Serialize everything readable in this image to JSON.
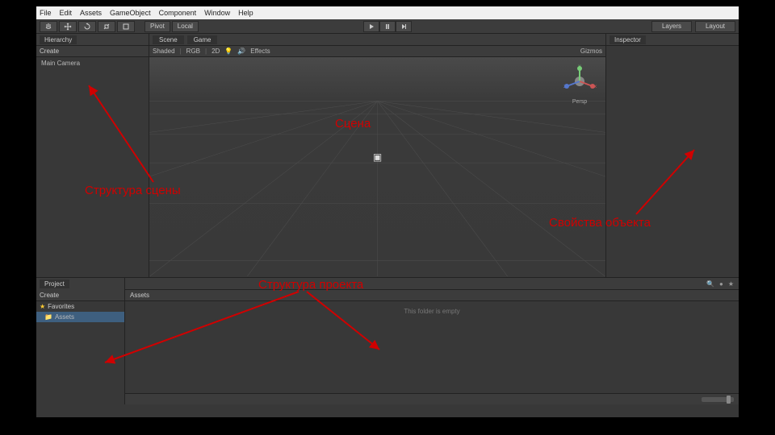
{
  "menubar": [
    "File",
    "Edit",
    "Assets",
    "GameObject",
    "Component",
    "Window",
    "Help"
  ],
  "toolbar": {
    "pivot": "Pivot",
    "local": "Local",
    "layers": "Layers",
    "layout": "Layout"
  },
  "hierarchy": {
    "tab": "Hierarchy",
    "create": "Create",
    "item": "Main Camera"
  },
  "scene": {
    "tab_scene": "Scene",
    "tab_game": "Game",
    "shaded": "Shaded",
    "rgb": "RGB",
    "twod": "2D",
    "effects": "Effects",
    "gizmos": "Gizmos",
    "persp": "Persp"
  },
  "inspector": {
    "tab": "Inspector"
  },
  "project": {
    "tab": "Project",
    "create": "Create",
    "favorites": "Favorites",
    "assets": "Assets",
    "assets_header": "Assets",
    "empty": "This folder is empty"
  },
  "annotations": {
    "scene": "Сцена",
    "hierarchy": "Структура сцены",
    "inspector": "Свойства объекта",
    "project": "Структура проекта"
  }
}
